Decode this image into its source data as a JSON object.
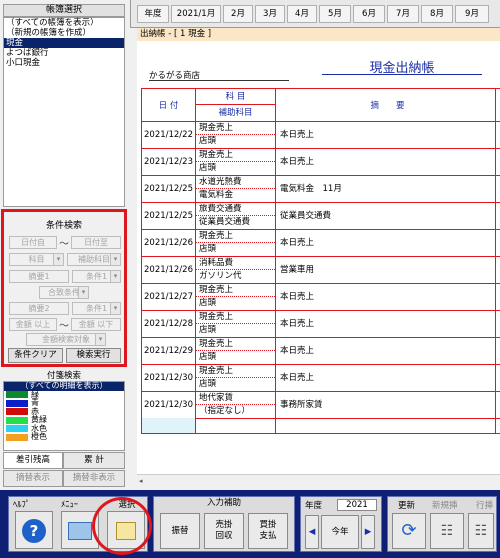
{
  "left_panel": {
    "ledger_select_title": "帳簿選択",
    "ledger_items": [
      "（すべての帳簿を表示）",
      "（新規の帳簿を作成）",
      "現金",
      "よつば銀行",
      "小口現金"
    ],
    "selected_ledger": "現金",
    "condition_search": {
      "title": "条件検索",
      "date_from": "日付自",
      "date_to": "日付至",
      "tilde": "〜",
      "account": "科目",
      "sub_account": "補助科目",
      "summary1": "摘要1",
      "cond1": "条件1",
      "combine": "合致条件",
      "summary2": "摘要2",
      "cond2": "条件1",
      "amount_from": "金額 以上",
      "amount_to": "金額 以下",
      "amount_target": "金額検索対象",
      "clear_button": "条件クリア",
      "search_button": "検索実行"
    },
    "tag_search": {
      "title": "付箋検索",
      "items": [
        {
          "label": "（すべての明細を表示）",
          "color": ""
        },
        {
          "label": "緑",
          "color": "#0a8a2a"
        },
        {
          "label": "青",
          "color": "#0a1fc8"
        },
        {
          "label": "赤",
          "color": "#d10a0a"
        },
        {
          "label": "黄緑",
          "color": "#22e04a"
        },
        {
          "label": "水色",
          "color": "#2ad2f0"
        },
        {
          "label": "橙色",
          "color": "#f2a022"
        }
      ]
    },
    "tabs": {
      "balance": "差引残高",
      "total": "累 計",
      "memo_show": "摘替表示",
      "memo_hide": "摘替非表示"
    }
  },
  "year_bar": {
    "labels": [
      "年度",
      "2021/1月",
      "2月",
      "3月",
      "4月",
      "5月",
      "6月",
      "7月",
      "8月",
      "9月"
    ]
  },
  "breadcrumb": "出納帳 - [ 1 現金 ]",
  "ledger": {
    "company": "かるがる商店",
    "title": "現金出納帳",
    "col_date": "日 付",
    "col_account": "科 目",
    "col_sub_account": "補助科目",
    "col_summary": "摘　　要",
    "rows": [
      {
        "date": "2021/12/22",
        "account": "現金売上",
        "sub": "店頭",
        "summary": "本日売上"
      },
      {
        "date": "2021/12/23",
        "account": "現金売上",
        "sub": "店頭",
        "summary": "本日売上"
      },
      {
        "date": "2021/12/25",
        "account": "水道光熱費",
        "sub": "電気料金",
        "summary": "電気料金　11月"
      },
      {
        "date": "2021/12/25",
        "account": "旅費交通費",
        "sub": "従業員交通費",
        "summary": "従業員交通費"
      },
      {
        "date": "2021/12/26",
        "account": "現金売上",
        "sub": "店頭",
        "summary": "本日売上"
      },
      {
        "date": "2021/12/26",
        "account": "消耗品費",
        "sub": "ガソリン代",
        "summary": "営業車用"
      },
      {
        "date": "2021/12/27",
        "account": "現金売上",
        "sub": "店頭",
        "summary": "本日売上"
      },
      {
        "date": "2021/12/28",
        "account": "現金売上",
        "sub": "店頭",
        "summary": "本日売上"
      },
      {
        "date": "2021/12/29",
        "account": "現金売上",
        "sub": "店頭",
        "summary": "本日売上"
      },
      {
        "date": "2021/12/30",
        "account": "現金売上",
        "sub": "店頭",
        "summary": "本日売上"
      },
      {
        "date": "2021/12/30",
        "account": "地代家賃",
        "sub": "（指定なし）",
        "summary": "事務所家賃"
      }
    ]
  },
  "toolbar": {
    "help": "ﾍﾙﾌﾟ",
    "menu": "ﾒﾆｭｰ",
    "select": "選択",
    "input_assist": "入力補助",
    "transfer": "振替",
    "sales_collect": "売掛\n回収",
    "payable_pay": "買掛\n支払",
    "year_label": "年度",
    "year_value": "2021",
    "this_year": "今年",
    "update": "更新",
    "new_insert": "新規挿",
    "row_label": "行挿"
  },
  "colors": {
    "highlight": "#e0161e",
    "toolbar_bg": "#0f1f73",
    "breadcrumb_bg": "#fbe7c6",
    "title_blue": "#1a2ea8"
  }
}
